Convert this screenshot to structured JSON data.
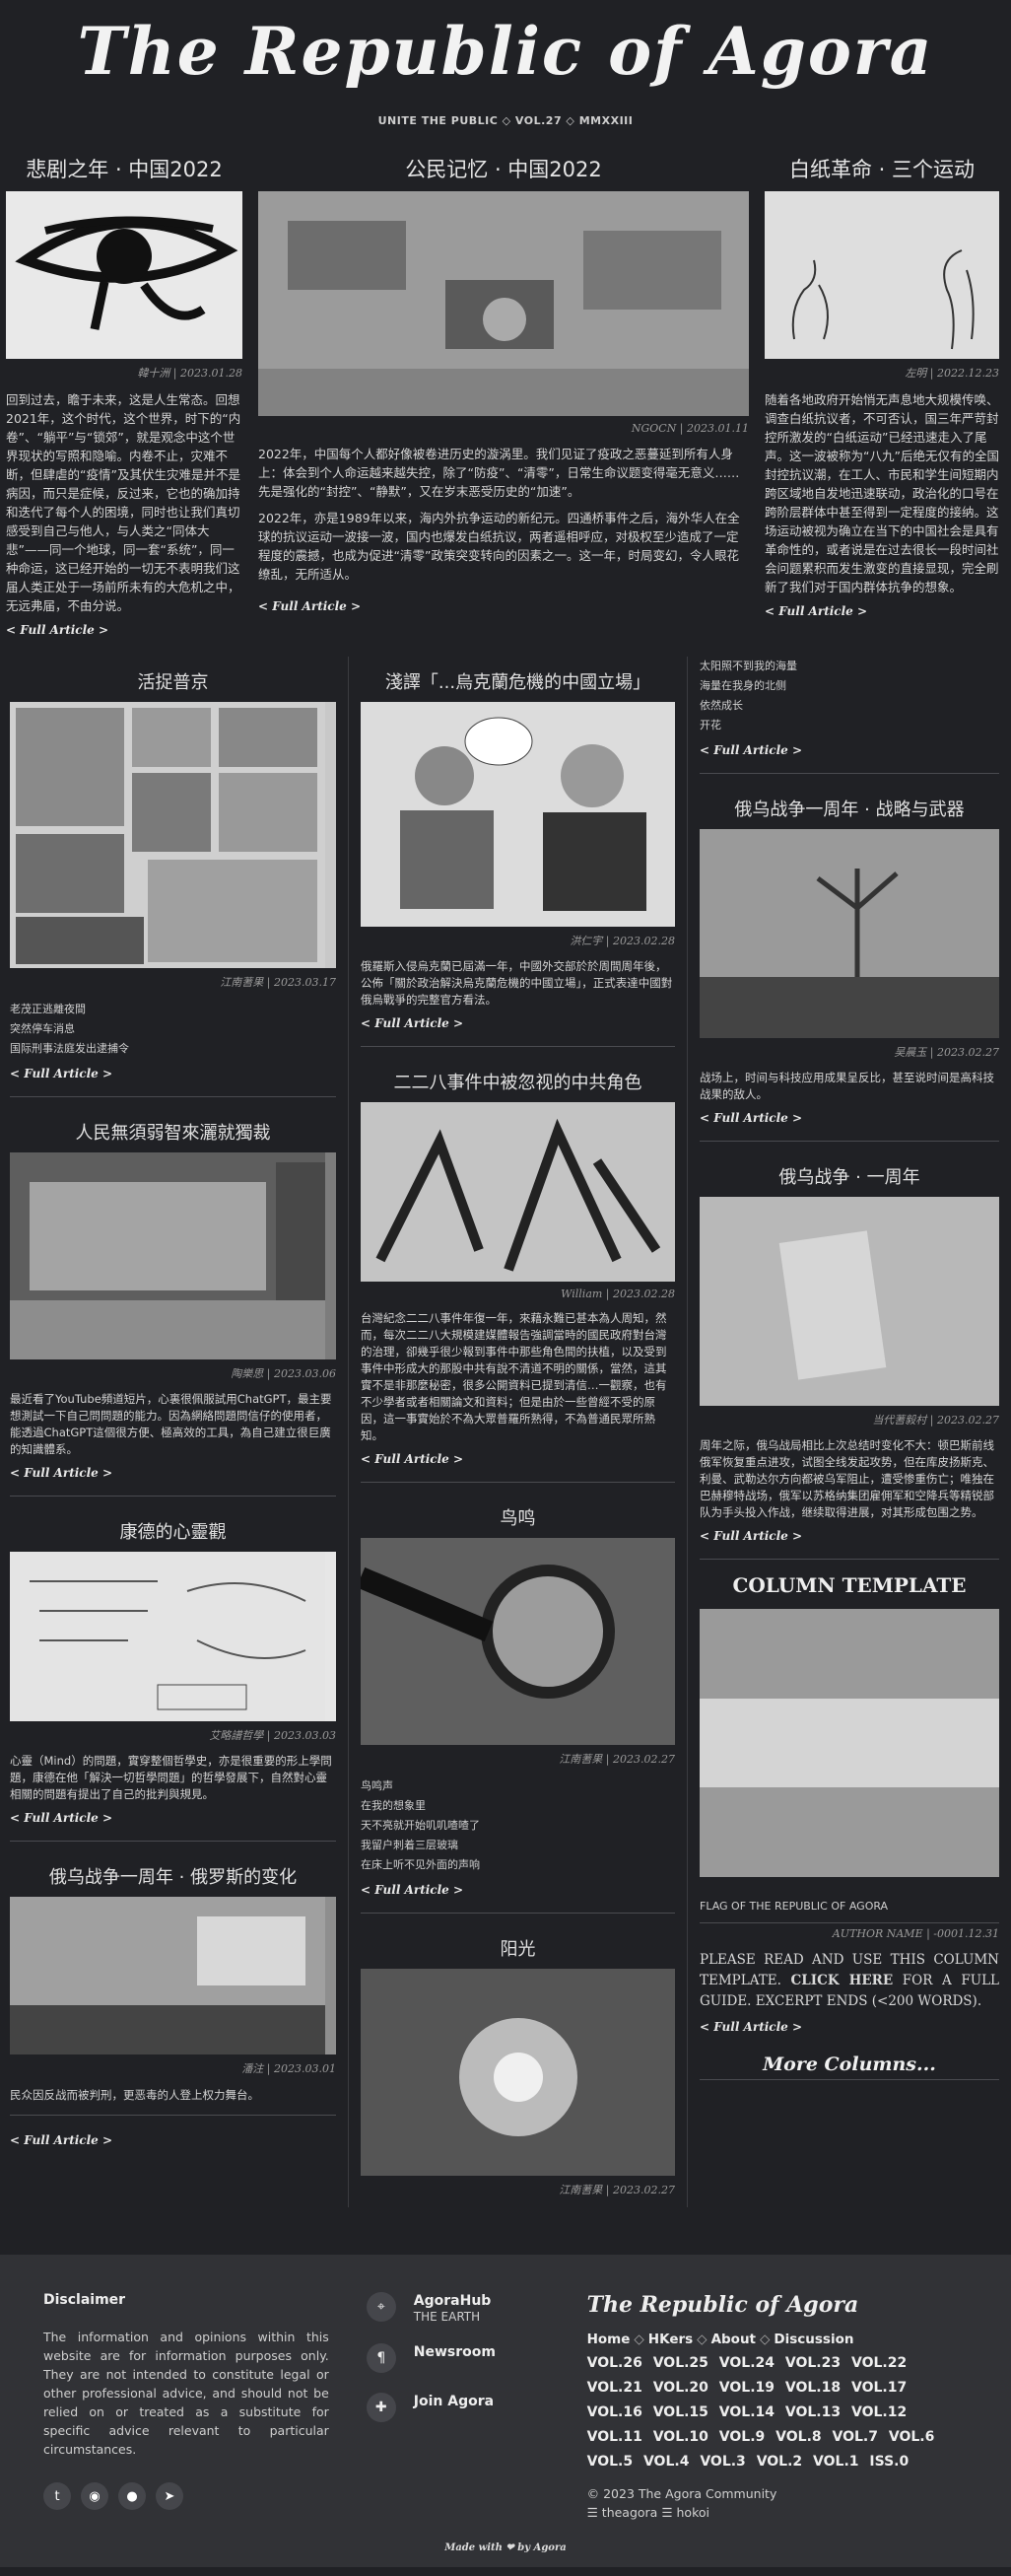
{
  "masthead": {
    "title": "The Republic of Agora",
    "subtitle": "UNITE THE PUBLIC ◇ VOL.27 ◇ MMXXIII"
  },
  "top": [
    {
      "title": "悲剧之年 · 中国2022",
      "byline": "韓十洲 | 2023.01.28",
      "text": "回到过去，瞻于未来，这是人生常态。回想2021年，这个时代，这个世界，时下的“内卷”、“躺平”与“锁郊”，就是观念中这个世界现状的写照和隐喻。内卷不止，灾难不断，但肆虐的“疫情”及其伏生灾难是并不是病因，而只是症候，反过来，它也的确加持和迭代了每个人的困境，同时也让我们真切感受到自己与他人，与人类之“同体大悲”——同一个地球，同一套“系统”，同一种命运，这已经开始的一切无不表明我们这届人类正处于一场前所未有的大危机之中，无远弗届，不由分说。",
      "more": "< Full Article >"
    },
    {
      "title": "公民记忆 · 中国2022",
      "byline": "NGOCN | 2023.01.11",
      "paras": [
        "2022年，中国每个人都好像被卷进历史的漩涡里。我们见证了疫政之恶蔓延到所有人身上：体会到个人命运越来越失控，除了“防疫”、“清零”，日常生命议题变得毫无意义……先是强化的“封控”、“静默”，又在岁末恶受历史的“加速”。",
        "2022年，亦是1989年以来，海内外抗争运动的新纪元。四通桥事件之后，海外华人在全球的抗议运动一波接一波，国内也爆发白纸抗议，两者遥相呼应，对极权至少造成了一定程度的震撼，也成为促进“清零”政策突变转向的因素之一。这一年，时局变幻，令人眼花缭乱，无所适从。"
      ],
      "more": "< Full Article >"
    },
    {
      "title": "白纸革命 · 三个运动",
      "byline": "左明 | 2022.12.23",
      "text": "随着各地政府开始悄无声息地大规模传唤、调查白纸抗议者，不可否认，国三年严苛封控所激发的“白纸运动”已经迅速走入了尾声。这一波被称为“八九”后绝无仅有的全国封控抗议潮，在工人、市民和学生间短期内跨区域地自发地迅速联动，政治化的口号在跨阶层群体中甚至得到一定程度的接纳。这场运动被视为确立在当下的中国社会是具有革命性的，或者说是在过去很长一段时间社会问题累积而发生激变的直接显现，完全刷新了我们对于国内群体抗争的想象。",
      "more": "< Full Article >"
    }
  ],
  "col1": [
    {
      "title": "活捉普京",
      "byline": "江南蓍果 | 2023.03.17",
      "lines": [
        "老茂正逃離夜間",
        "突然停车消息",
        "国际刑事法庭发出逮捕令"
      ],
      "more": "< Full Article >"
    },
    {
      "title": "人民無須弱智來灑就獨裁",
      "byline": "陶樂思 | 2023.03.06",
      "text": "最近看了YouTube頻道短片，心裏很佩服試用ChatGPT，最主要想測試一下自己問問題的能力。因為網絡問題問信仔的使用者，能透過ChatGPT這個很方便、極高效的工具，為自己建立很巨廣的知識體系。",
      "more": "< Full Article >"
    },
    {
      "title": "康德的心靈觀",
      "byline": "艾略譜哲學 | 2023.03.03",
      "text": "心靈（Mind）的問題，實穿整個哲學史，亦是很重要的形上學問題，康德在他「解決一切哲學問題」的哲學發展下，自然對心靈相關的問題有提出了自己的批判與規見。",
      "more": "< Full Article >"
    },
    {
      "title": "俄乌战争一周年 · 俄罗斯的变化",
      "byline": "潘注 | 2023.03.01",
      "text": "民众因反战而被判刑，更恶毒的人登上权力舞台。",
      "more": "< Full Article >"
    }
  ],
  "col2": [
    {
      "title": "淺譯「...烏克蘭危機的中國立場」",
      "byline": "洪仁宇 | 2023.02.28",
      "text": "俄羅斯入侵烏克蘭已屆滿一年，中國外交部於於周間周年後，公佈「關於政治解決烏克蘭危機的中國立場」，正式表達中國對俄烏戰爭的完整官方看法。",
      "more": "< Full Article >"
    },
    {
      "title": "二二八事件中被忽视的中共角色",
      "byline": "William | 2023.02.28",
      "text": "台灣紀念二二八事件年復一年，來藉永難已甚本為人周知，然而，每次二二八大規模建媒體報告強調當時的國民政府對台灣的治理，卻幾乎很少報到事件中那些角色間的扶植，以及受到事件中形成大的那股中共有說不清道不明的關係，當然，這其實不是非那麼秘密，很多公開資料已提到清信…一觀察，也有不少學者或者相關論文和資料；但是由於一些曾經不受的原因，這一事實始於不為大眾普羅所熟得，不為普通民眾所熟知。",
      "more": "< Full Article >"
    },
    {
      "title": "鸟鸣",
      "byline": "江南蓍果 | 2023.02.27",
      "lines": [
        "鸟鸣声",
        "在我的想象里",
        "天不亮就开始叽叽喳喳了",
        "我留户刺着三层玻璃",
        "在床上听不见外面的声响"
      ],
      "more": "< Full Article >"
    },
    {
      "title": "阳光",
      "byline": "江南蓍果 | 2023.02.27"
    }
  ],
  "col3": [
    {
      "lines": [
        "太阳照不到我的海量",
        "海量在我身的北侧",
        "依然成长",
        "开花"
      ],
      "more": "< Full Article >"
    },
    {
      "title": "俄乌战争一周年 · 战略与武器",
      "byline": "吴晨玉 | 2023.02.27",
      "text": "战场上，时间与科技应用成果呈反比，甚至说时间是高科技战果的敌人。",
      "more": "< Full Article >"
    },
    {
      "title": "俄乌战争 · 一周年",
      "byline": "当代蓍毅村 | 2023.02.27",
      "text": "周年之际，俄乌战局相比上次总结时变化不大：顿巴斯前线俄军恢复重点进攻，试图全线发起攻势，但在库皮扬斯克、利曼、武勒达尔方向都被乌军阻止，遭受惨重伤亡；唯独在巴赫穆特战场，俄军以苏格纳集团雇佣军和空降兵等精锐部队为手头投入作战，继续取得进展，对其形成包围之势。",
      "more": "< Full Article >"
    }
  ],
  "template": {
    "title": "COLUMN TEMPLATE",
    "caption": "FLAG OF THE REPUBLIC OF AGORA",
    "byline": "AUTHOR NAME | -0001.12.31",
    "text_before": "PLEASE READ AND USE THIS COLUMN TEMPLATE.",
    "link": "CLICK HERE",
    "text_after": "FOR A FULL GUIDE. EXCERPT ENDS (<200 WORDS).",
    "more": "< Full Article >",
    "more_columns": "More Columns...",
    "flag_colors": [
      "#9a9a9a",
      "#d4d4d4",
      "#9a9a9a"
    ]
  },
  "footer": {
    "disclaimer_title": "Disclaimer",
    "disclaimer": "The information and opinions within this website are for information purposes only. They are not intended to constitute legal or other professional advice, and should not be relied on or treated as a substitute for specific advice relevant to particular circumstances.",
    "social": [
      "twitter-icon",
      "github-icon",
      "reddit-icon",
      "telegram-icon"
    ],
    "links": [
      {
        "title": "AgoraHub",
        "sub": "THE EARTH",
        "icon": "location-icon"
      },
      {
        "title": "Newsroom",
        "sub": "",
        "icon": "paragraph-icon"
      },
      {
        "title": "Join Agora",
        "sub": "",
        "icon": "puzzle-icon"
      }
    ],
    "brand": "The Republic of Agora",
    "nav": [
      "Home",
      "HKers",
      "About",
      "Discussion"
    ],
    "vols": [
      "VOL.26",
      "VOL.25",
      "VOL.24",
      "VOL.23",
      "VOL.22",
      "VOL.21",
      "VOL.20",
      "VOL.19",
      "VOL.18",
      "VOL.17",
      "VOL.16",
      "VOL.15",
      "VOL.14",
      "VOL.13",
      "VOL.12",
      "VOL.11",
      "VOL.10",
      "VOL.9",
      "VOL.8",
      "VOL.7",
      "VOL.6",
      "VOL.5",
      "VOL.4",
      "VOL.3",
      "VOL.2",
      "VOL.1",
      "ISS.0"
    ],
    "copyright": "© 2023 The Agora Community",
    "handles": "☰ theagora ☰ hokoi",
    "made": "Made with ❤ by Agora"
  }
}
